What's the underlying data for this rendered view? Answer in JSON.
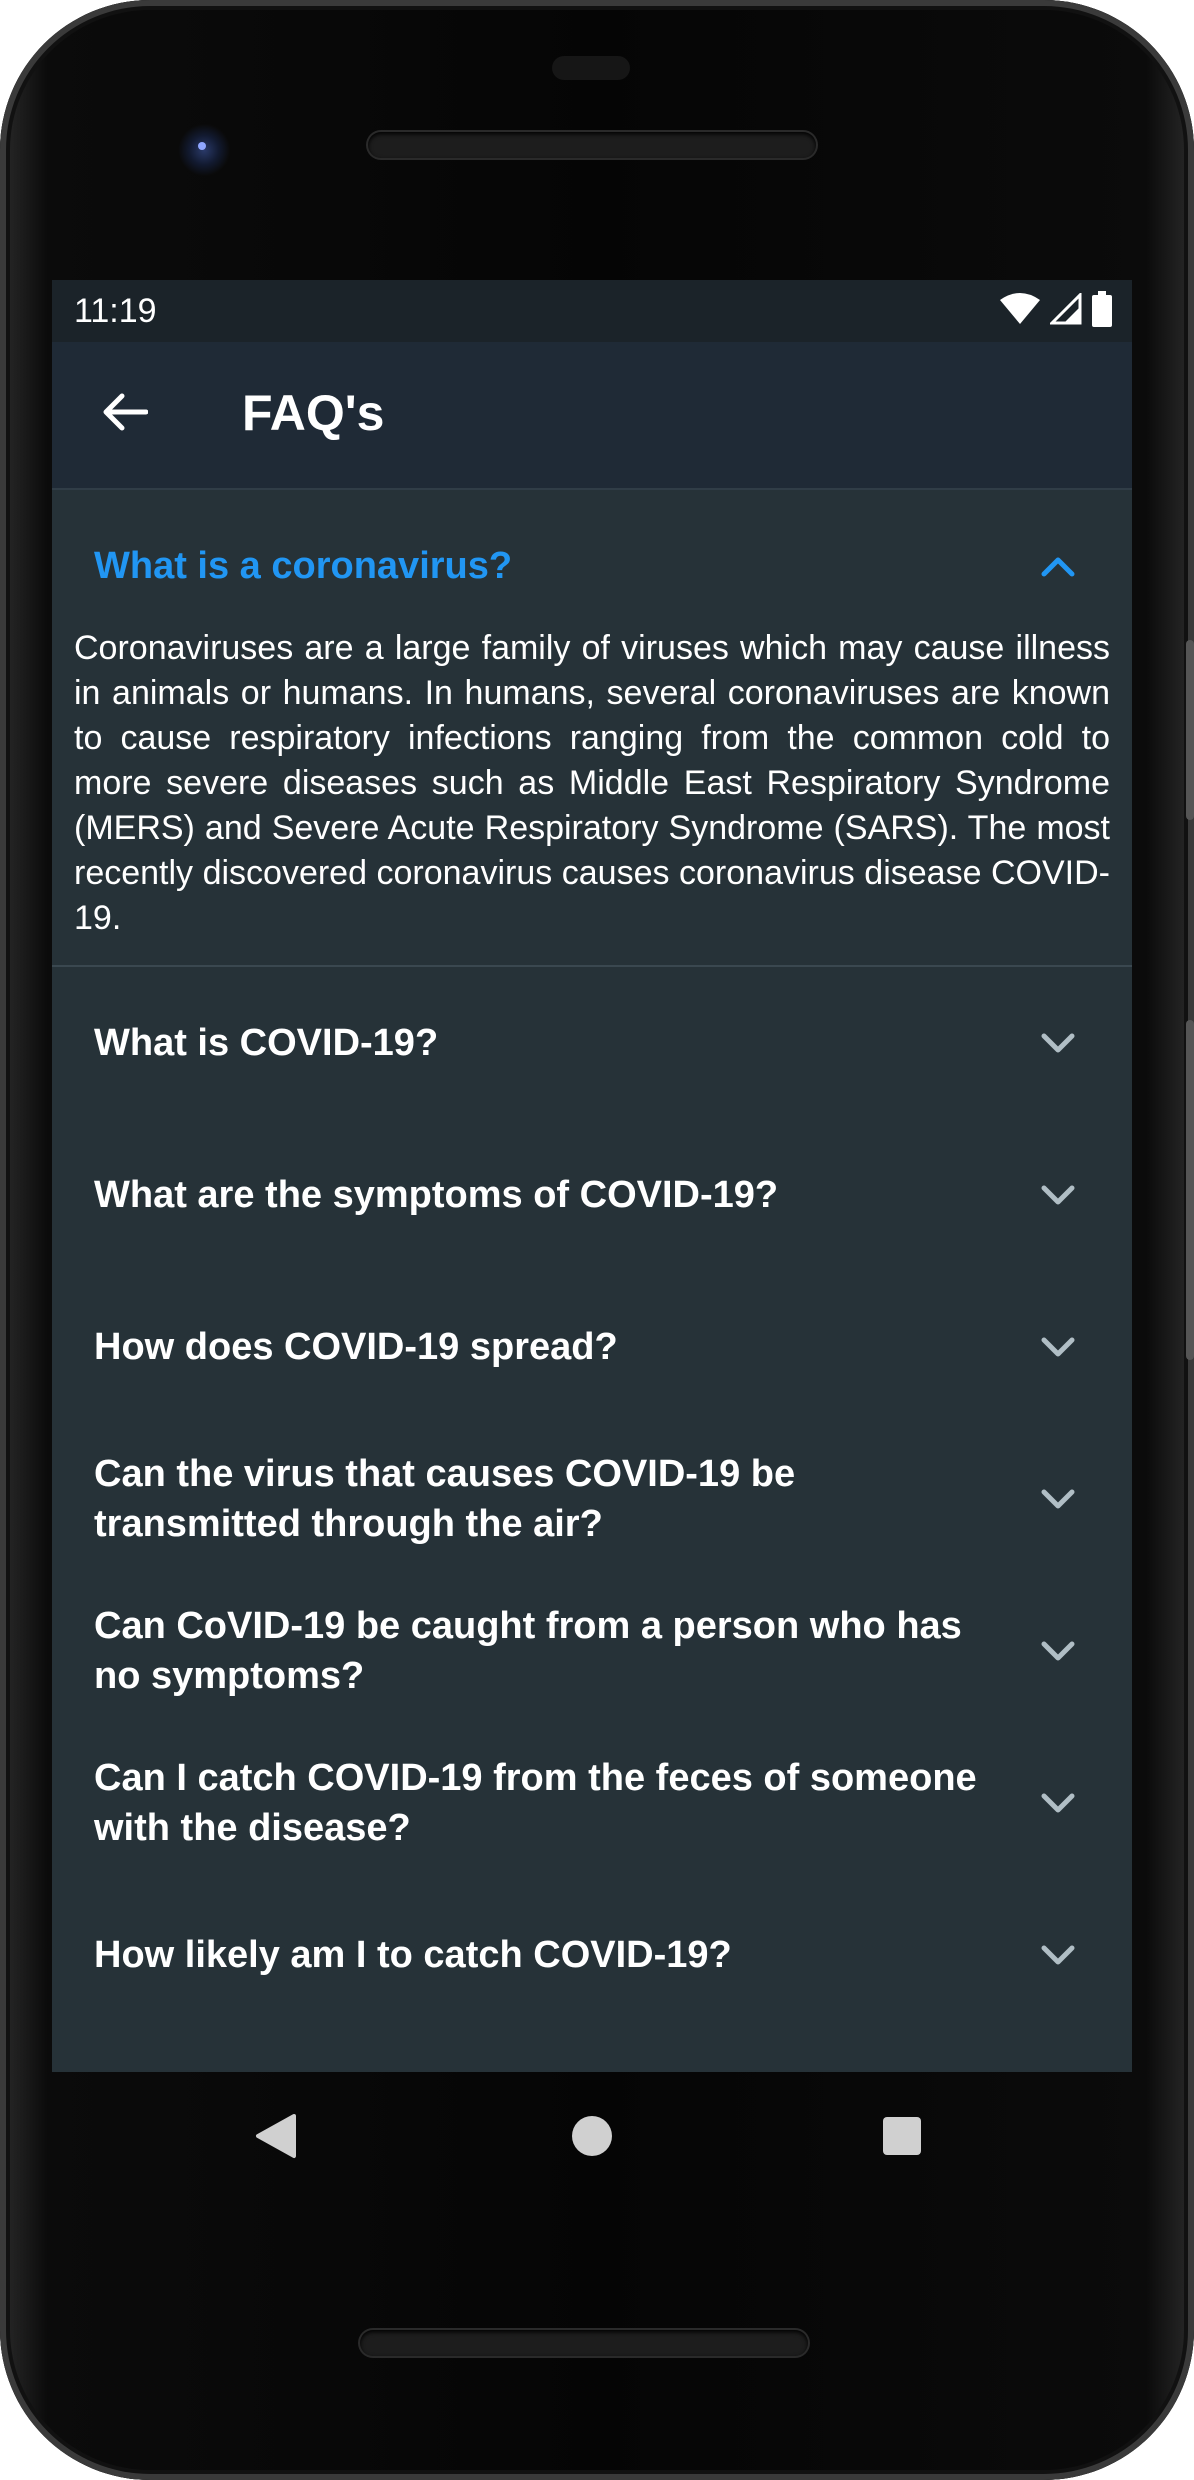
{
  "status_bar": {
    "time": "11:19",
    "icons": [
      "wifi-icon",
      "signal-icon",
      "battery-icon"
    ]
  },
  "app_bar": {
    "title": "FAQ's",
    "back_icon": "arrow-left-icon"
  },
  "colors": {
    "screen_bg": "#263238",
    "app_bar_bg": "#1f2a36",
    "status_bar_bg": "#1b2329",
    "accent": "#2196f3",
    "text": "#ffffff",
    "chevron": "#b0bec5"
  },
  "faqs": [
    {
      "question": "What is a coronavirus?",
      "expanded": true,
      "answer": "Coronaviruses are a large family of viruses which may cause illness in animals or humans. In humans, several coronaviruses are known to cause respiratory infections ranging from the common cold to more severe diseases such as Middle East Respiratory Syndrome (MERS) and Severe Acute Respiratory Syndrome (SARS). The most recently discovered coronavirus causes coronavirus disease COVID-19."
    },
    {
      "question": "What is COVID-19?",
      "expanded": false
    },
    {
      "question": "What are the symptoms of COVID-19?",
      "expanded": false
    },
    {
      "question": "How does COVID-19 spread?",
      "expanded": false
    },
    {
      "question": "Can the virus that causes COVID-19 be transmitted through the air?",
      "expanded": false
    },
    {
      "question": "Can CoVID-19 be caught from a person who has no symptoms?",
      "expanded": false
    },
    {
      "question": "Can I catch COVID-19 from the feces of someone with the disease?",
      "expanded": false
    },
    {
      "question": "How likely am I to catch COVID-19?",
      "expanded": false
    }
  ],
  "nav_bar": {
    "buttons": [
      "back-triangle-icon",
      "home-circle-icon",
      "recents-square-icon"
    ]
  }
}
